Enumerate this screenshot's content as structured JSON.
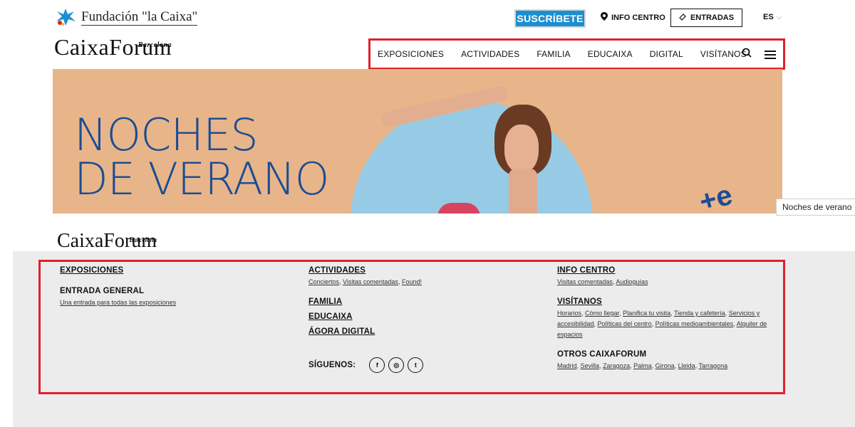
{
  "header": {
    "fundacion_logo_text": "Fundación \"la Caixa\"",
    "brand": "CaixaForum",
    "brand_city": "Barcelona",
    "subscribe_label": "SUSCRÍBETE",
    "info_centro_label": "INFO CENTRO",
    "entradas_label": "ENTRADAS",
    "language": "ES",
    "brand_color": "#1a8fd1",
    "highlight_color": "#e0202e"
  },
  "nav": {
    "items": [
      "EXPOSICIONES",
      "ACTIVIDADES",
      "FAMILIA",
      "EDUCAIXA",
      "DIGITAL",
      "VISÍTANOS"
    ],
    "icons": [
      "search-icon",
      "menu-icon"
    ]
  },
  "hero": {
    "title_line1": "NOCHES",
    "title_line2": "DE VERANO",
    "tooltip": "Noches de verano",
    "title_color": "#1c4d93",
    "background": "#e8b58a"
  },
  "footer_logo": {
    "brand": "CaixaForum",
    "city": "Barcelona"
  },
  "footer": {
    "col1": {
      "heading": "EXPOSICIONES",
      "sub_heading": "ENTRADA GENERAL",
      "sub_link": "Una entrada para todas las exposiciones"
    },
    "col2": {
      "actividades": "ACTIVIDADES",
      "actividades_links": [
        "Conciertos",
        "Visitas comentadas",
        "Found!"
      ],
      "familia": "FAMILIA",
      "educaixa": "EDUCAIXA",
      "agora": "ÁGORA DIGITAL",
      "siguenos": "SÍGUENOS:",
      "social": [
        "f",
        "◎",
        "t"
      ]
    },
    "col3": {
      "info_centro": "INFO CENTRO",
      "info_links": [
        "Visitas comentadas",
        "Audioguías"
      ],
      "visitanos": "VISÍTANOS",
      "visitanos_links": [
        "Horarios",
        "Cómo llegar",
        "Planifica tu visita",
        "Tienda y cafetería",
        "Servicios y accesibilidad",
        "Políticas del centro",
        "Políticas medioambientales",
        "Alquiler de espacios"
      ],
      "otros": "OTROS CAIXAFORUM",
      "otros_links": [
        "Madrid",
        "Sevilla",
        "Zaragoza",
        "Palma",
        "Girona",
        "Lleida",
        "Tarragona"
      ]
    }
  }
}
